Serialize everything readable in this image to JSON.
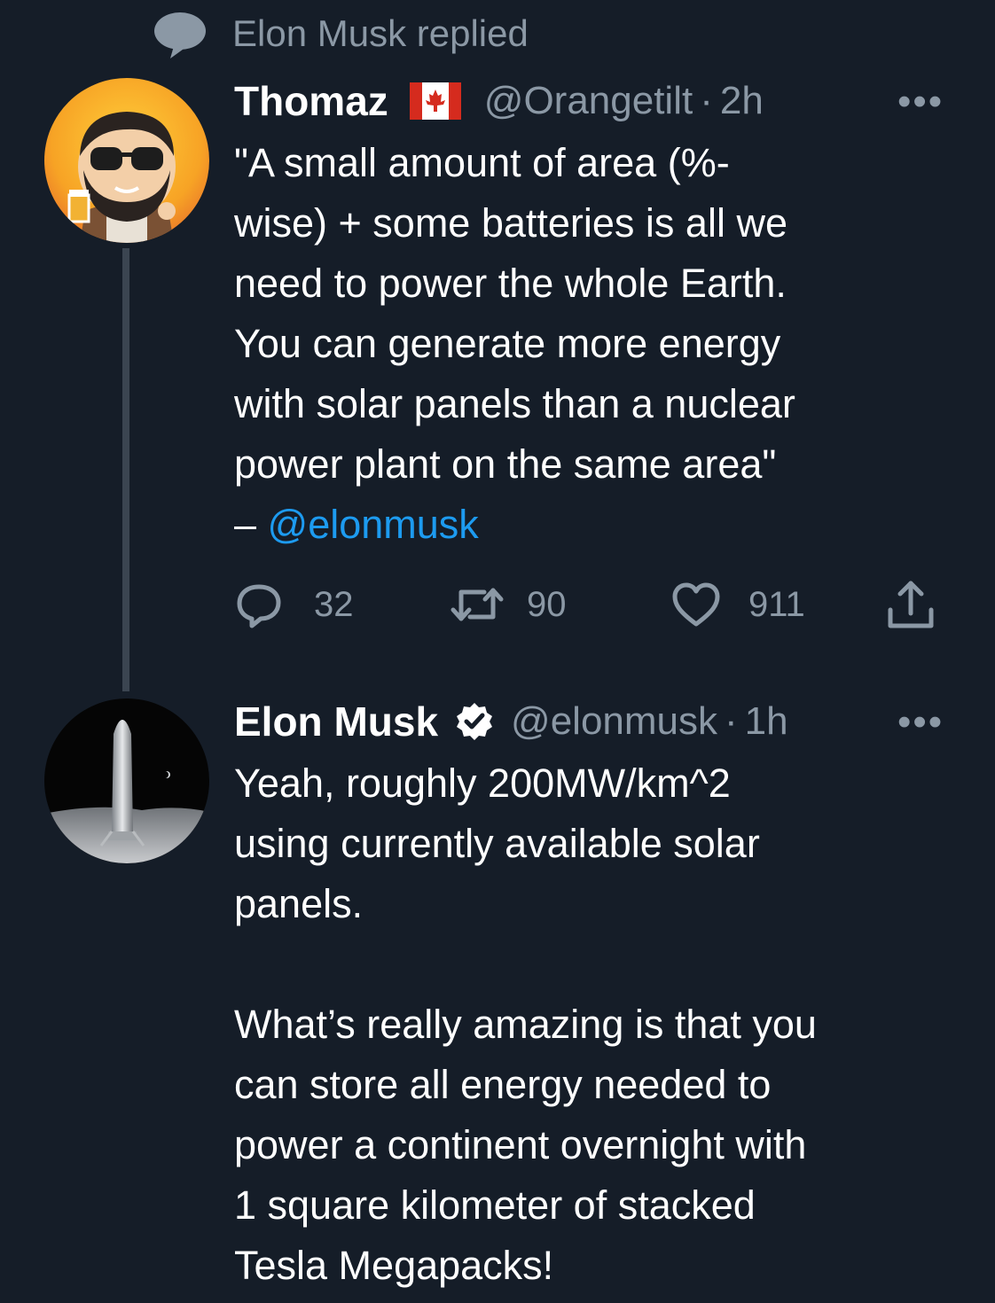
{
  "context": {
    "icon": "speech-bubble-icon",
    "text": "Elon Musk replied"
  },
  "tweets": [
    {
      "name": "Thomaz",
      "flag": "canada-flag",
      "handle": "@Orangetilt",
      "separator": "·",
      "time": "2h",
      "more": "•••",
      "text": "\"A small amount of area (%-\nwise) + some batteries is all we\nneed to power the whole Earth.\nYou can generate more energy\nwith solar panels than a nuclear\npower plant on the same area\"\n– ",
      "mention": "@elonmusk",
      "actions": {
        "replies": "32",
        "retweets": "90",
        "likes": "911"
      }
    },
    {
      "name": "Elon Musk",
      "verified": true,
      "handle": "@elonmusk",
      "separator": "·",
      "time": "1h",
      "more": "•••",
      "text": "Yeah, roughly 200MW/km^2\nusing currently available solar\npanels.\n\nWhat’s really amazing is that you\ncan store all energy needed to\npower a continent overnight with\n1 square kilometer of stacked\nTesla Megapacks!"
    }
  ],
  "colors": {
    "background": "#151d28",
    "secondary_text": "#8b98a5",
    "link": "#1d9bf0",
    "thread_line": "#3b4551"
  }
}
